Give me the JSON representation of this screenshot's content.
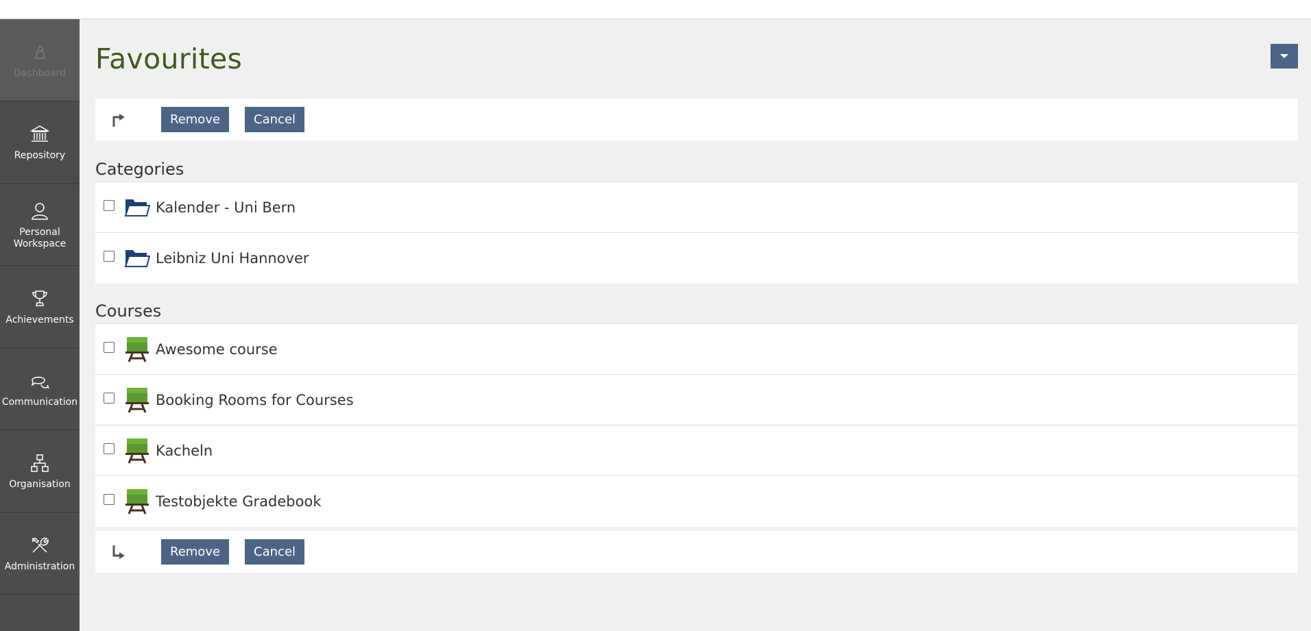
{
  "sidebar": {
    "items": [
      {
        "label": "Dashboard",
        "icon": "dashboard-icon"
      },
      {
        "label": "Repository",
        "icon": "repository-icon"
      },
      {
        "label": "Personal\nWorkspace",
        "icon": "person-icon"
      },
      {
        "label": "Achievements",
        "icon": "trophy-icon"
      },
      {
        "label": "Communication",
        "icon": "chat-bubbles-icon"
      },
      {
        "label": "Organisation",
        "icon": "org-chart-icon"
      },
      {
        "label": "Administration",
        "icon": "tools-icon"
      }
    ]
  },
  "page": {
    "title": "Favourites"
  },
  "toolbar": {
    "remove_label": "Remove",
    "cancel_label": "Cancel"
  },
  "categories": {
    "heading": "Categories",
    "items": [
      {
        "title": "Kalender - Uni Bern"
      },
      {
        "title": "Leibniz Uni Hannover"
      }
    ]
  },
  "courses": {
    "heading": "Courses",
    "items": [
      {
        "title": "Awesome course"
      },
      {
        "title": "Booking Rooms for Courses"
      },
      {
        "title": "Kacheln"
      },
      {
        "title": "Testobjekte Gradebook"
      }
    ]
  },
  "colors": {
    "accent": "#4c6586",
    "title": "#3f5a1e",
    "sidebar": "#4c4c4c"
  }
}
